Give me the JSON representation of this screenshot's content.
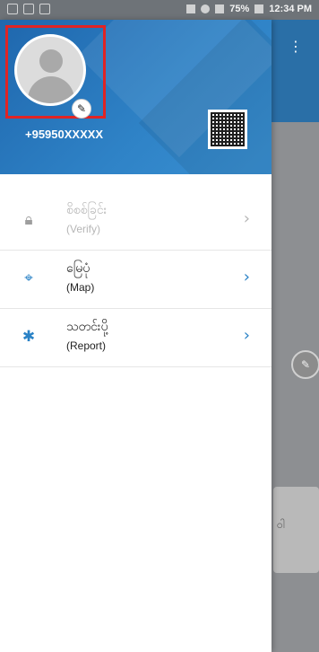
{
  "status_bar": {
    "battery": "75%",
    "time": "12:34 PM"
  },
  "drawer": {
    "header": {
      "phone": "+95950XXXXX"
    },
    "menu": [
      {
        "title": "စိစစ်ခြင်း",
        "subtitle": "(Verify)",
        "enabled": false
      },
      {
        "title": "မြေပုံ",
        "subtitle": "(Map)",
        "enabled": true
      },
      {
        "title": "သတင်းပို့",
        "subtitle": "(Report)",
        "enabled": true
      }
    ]
  },
  "background_app": {
    "card_partial_text": "ဝါ"
  },
  "colors": {
    "primary": "#2a82c6",
    "header_dark": "#1f67ad",
    "highlight_red": "#e02424",
    "disabled_text": "#b6b6b6"
  },
  "icons": {
    "lock": "lock-icon",
    "map": "location-target-icon",
    "report": "bug-icon",
    "edit": "pencil-icon"
  }
}
